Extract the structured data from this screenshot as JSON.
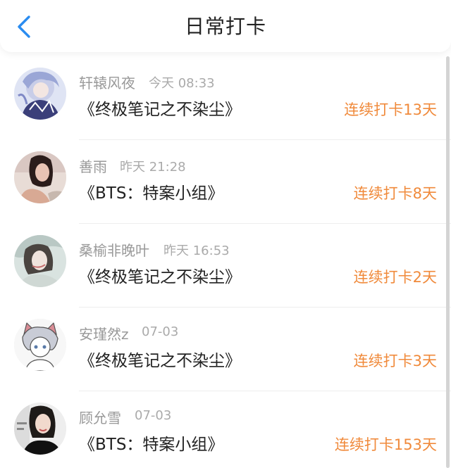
{
  "header": {
    "title": "日常打卡",
    "back_icon": "chevron-left-icon",
    "accent": "#2a8cf0"
  },
  "colors": {
    "streak": "#f08a3b",
    "name": "#999999",
    "book": "#222222"
  },
  "items": [
    {
      "name": "轩辕风夜",
      "time": "今天 08:33",
      "book": "《终极笔记之不染尘》",
      "streak": "连续打卡13天"
    },
    {
      "name": "善雨",
      "time": "昨天 21:28",
      "book": "《BTS：特案小组》",
      "streak": "连续打卡8天"
    },
    {
      "name": "桑榆非晚叶",
      "time": "昨天 16:53",
      "book": "《终极笔记之不染尘》",
      "streak": "连续打卡2天"
    },
    {
      "name": "安瑾然z",
      "time": "07-03",
      "book": "《终极笔记之不染尘》",
      "streak": "连续打卡3天"
    },
    {
      "name": "顾允雪",
      "time": "07-03",
      "book": "《BTS：特案小组》",
      "streak": "连续打卡153天"
    }
  ]
}
